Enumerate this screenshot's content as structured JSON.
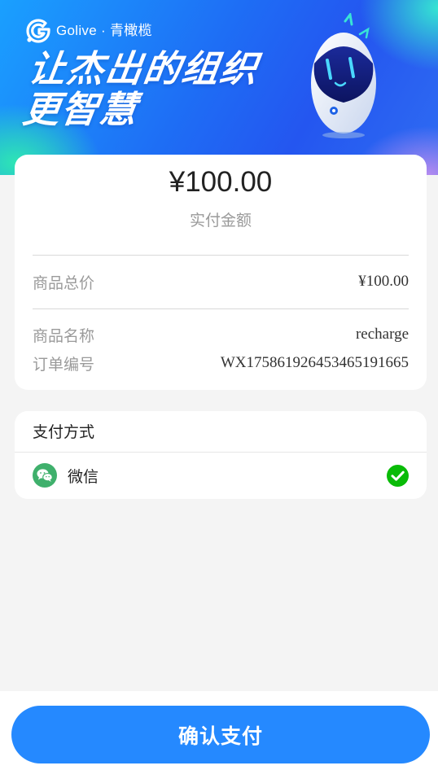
{
  "banner": {
    "brand": "Golive · 青橄榄",
    "slogan_line1": "让杰出的组织",
    "slogan_line2": "更智慧"
  },
  "order": {
    "amount": "¥100.00",
    "amount_label": "实付金额",
    "rows": [
      {
        "label": "商品总价",
        "value": "¥100.00"
      },
      {
        "label": "商品名称",
        "value": "recharge"
      },
      {
        "label": "订单编号",
        "value": "WX175861926453465191665"
      }
    ]
  },
  "payment": {
    "title": "支付方式",
    "option_name": "微信",
    "selected": true
  },
  "footer": {
    "confirm_label": "确认支付"
  },
  "colors": {
    "accent": "#2589ff",
    "wechat": "#3fb06c",
    "check": "#09bb07"
  },
  "icons": {
    "logo": "golive-logo-icon",
    "payment": "wechat-icon",
    "selected": "check-circle-icon"
  }
}
